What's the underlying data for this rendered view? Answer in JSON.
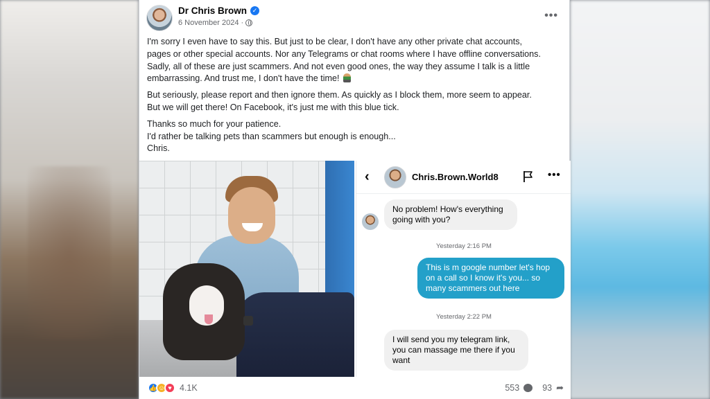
{
  "post": {
    "author": "Dr Chris Brown",
    "date": "6 November 2024",
    "date_separator": "·",
    "paragraphs": [
      [
        "I'm sorry I even have to say this. But just to be clear, I don't have any other private chat accounts,",
        "pages or other special accounts. Nor any Telegrams or chat rooms where I have offline conversations.",
        "Sadly, all of these are just scammers. And not even good ones, the way they assume I talk is a little",
        "embarrassing. And trust me, I don't have the time!"
      ],
      [
        "But seriously, please report and then ignore them. As quickly as I block them, more seem to appear.",
        "But we will get there! On Facebook, it's just me with this blue tick."
      ],
      [
        "Thanks so much for your patience.",
        "I'd rather be talking pets than scammers but enough is enough...",
        "Chris."
      ]
    ]
  },
  "chat": {
    "name": "Chris.Brown.World8",
    "messages": [
      {
        "type": "in",
        "text": "No problem! How's everything going with you?"
      },
      {
        "type": "time",
        "text": "Yesterday 2:16 PM"
      },
      {
        "type": "out",
        "text": "This is m google number let's hop on a call so I know it's you... so many scammers out here"
      },
      {
        "type": "time",
        "text": "Yesterday 2:22 PM"
      },
      {
        "type": "in",
        "text": "I will send you my telegram link, you can massage me there if you want"
      }
    ]
  },
  "footer": {
    "reaction_count": "4.1K",
    "comments": "553",
    "shares": "93"
  },
  "icons": {
    "verified": "verified-check-icon",
    "privacy": "globe-icon",
    "more": "more-horizontal-icon",
    "back": "chevron-left-icon",
    "report": "flag-icon",
    "comment": "comment-bubble-icon",
    "share": "share-arrow-icon"
  },
  "colors": {
    "brand_blue": "#1877f2",
    "outgoing_bubble": "#23a0c9",
    "incoming_bubble": "#f0f0f0"
  }
}
